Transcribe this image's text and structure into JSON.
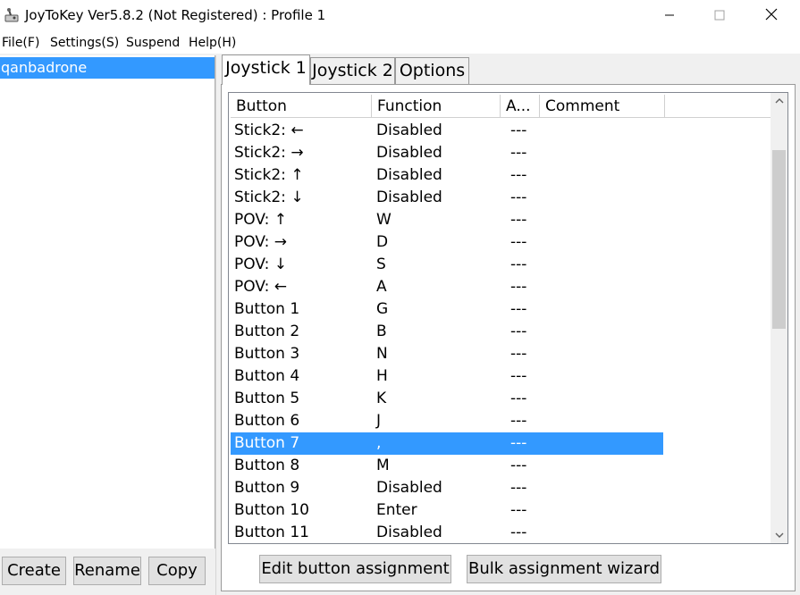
{
  "window": {
    "title": "JoyToKey Ver5.8.2 (Not Registered) : Profile 1",
    "minimize_glyph": "—",
    "maximize_glyph": "☐",
    "close_glyph": "✕"
  },
  "menu": [
    "File(F)",
    "Settings(S)",
    "Suspend",
    "Help(H)"
  ],
  "profiles": {
    "selected": "qanbadrone"
  },
  "left_buttons": {
    "create": "Create",
    "rename": "Rename",
    "copy": "Copy"
  },
  "tabs": [
    "Joystick 1",
    "Joystick 2",
    "Options"
  ],
  "table": {
    "columns": [
      "Button",
      "Function",
      "A...",
      "Comment"
    ],
    "rows": [
      {
        "button": "Stick2: ←",
        "function": "Disabled",
        "a": "---",
        "comment": ""
      },
      {
        "button": "Stick2: →",
        "function": "Disabled",
        "a": "---",
        "comment": ""
      },
      {
        "button": "Stick2: ↑",
        "function": "Disabled",
        "a": "---",
        "comment": ""
      },
      {
        "button": "Stick2: ↓",
        "function": "Disabled",
        "a": "---",
        "comment": ""
      },
      {
        "button": "POV: ↑",
        "function": "W",
        "a": "---",
        "comment": ""
      },
      {
        "button": "POV: →",
        "function": "D",
        "a": "---",
        "comment": ""
      },
      {
        "button": "POV: ↓",
        "function": "S",
        "a": "---",
        "comment": ""
      },
      {
        "button": "POV: ←",
        "function": "A",
        "a": "---",
        "comment": ""
      },
      {
        "button": "Button 1",
        "function": "G",
        "a": "---",
        "comment": ""
      },
      {
        "button": "Button 2",
        "function": "B",
        "a": "---",
        "comment": ""
      },
      {
        "button": "Button 3",
        "function": "N",
        "a": "---",
        "comment": ""
      },
      {
        "button": "Button 4",
        "function": "H",
        "a": "---",
        "comment": ""
      },
      {
        "button": "Button 5",
        "function": "K",
        "a": "---",
        "comment": ""
      },
      {
        "button": "Button 6",
        "function": "J",
        "a": "---",
        "comment": ""
      },
      {
        "button": "Button 7",
        "function": ",",
        "a": "---",
        "comment": "",
        "selected": true
      },
      {
        "button": "Button 8",
        "function": "M",
        "a": "---",
        "comment": ""
      },
      {
        "button": "Button 9",
        "function": "Disabled",
        "a": "---",
        "comment": ""
      },
      {
        "button": "Button 10",
        "function": "Enter",
        "a": "---",
        "comment": ""
      },
      {
        "button": "Button 11",
        "function": "Disabled",
        "a": "---",
        "comment": ""
      }
    ]
  },
  "bottom_buttons": {
    "edit": "Edit button assignment",
    "bulk": "Bulk assignment wizard"
  },
  "colors": {
    "selection": "#3399ff",
    "window_bg": "#f0f0f0",
    "button_bg": "#e1e1e1"
  },
  "icons": {
    "app": "joystick-icon",
    "scroll_up": "scroll-up-arrow-icon",
    "scroll_down": "scroll-down-arrow-icon"
  }
}
